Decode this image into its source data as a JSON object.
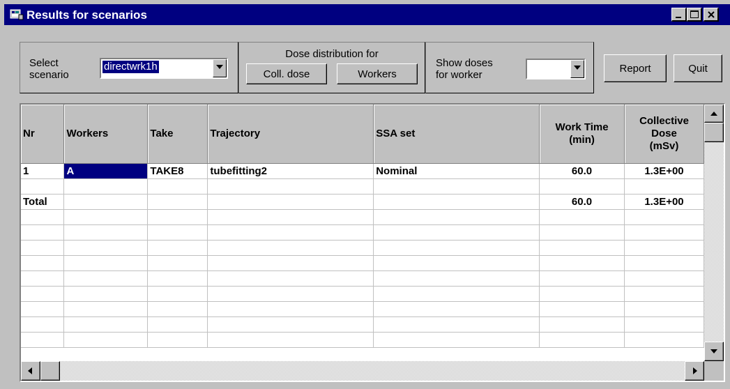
{
  "window": {
    "title": "Results for scenarios"
  },
  "toolbar": {
    "select_label_1": "Select",
    "select_label_2": "scenario",
    "scenario_value": "directwrk1h",
    "dose_dist_label": "Dose distribution for",
    "coll_dose_button": "Coll. dose",
    "workers_button": "Workers",
    "show_doses_label_1": "Show doses",
    "show_doses_label_2": "for worker",
    "worker_value": "",
    "report_button": "Report",
    "quit_button": "Quit"
  },
  "table": {
    "headers": {
      "nr": "Nr",
      "workers": "Workers",
      "take": "Take",
      "trajectory": "Trajectory",
      "ssa_set": "SSA set",
      "work_time_1": "Work Time",
      "work_time_2": "(min)",
      "coll_dose_1": "Collective",
      "coll_dose_2": "Dose",
      "coll_dose_3": "(mSv)"
    },
    "rows": [
      {
        "nr": "1",
        "workers": "A",
        "take": "TAKE8",
        "trajectory": "tubefitting2",
        "ssa": "Nominal",
        "time": "60.0",
        "dose": "1.3E+00"
      },
      {
        "nr": "",
        "workers": "",
        "take": "",
        "trajectory": "",
        "ssa": "",
        "time": "",
        "dose": ""
      },
      {
        "nr": "Total",
        "workers": "",
        "take": "",
        "trajectory": "",
        "ssa": "",
        "time": "60.0",
        "dose": "1.3E+00"
      }
    ]
  },
  "colors": {
    "titlebar": "#000080",
    "face": "#c0c0c0",
    "selection": "#000080"
  }
}
